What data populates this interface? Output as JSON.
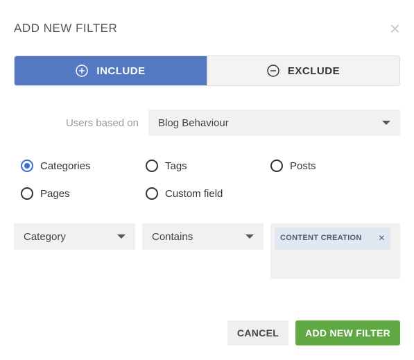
{
  "header": {
    "title": "ADD NEW FILTER"
  },
  "tabs": {
    "include": "INCLUDE",
    "exclude": "EXCLUDE"
  },
  "basis": {
    "label": "Users based on",
    "value": "Blog Behaviour"
  },
  "radios": {
    "categories": "Categories",
    "tags": "Tags",
    "posts": "Posts",
    "pages": "Pages",
    "custom_field": "Custom field"
  },
  "criteria": {
    "field": "Category",
    "operator": "Contains"
  },
  "chip": {
    "label": "CONTENT CREATION"
  },
  "footer": {
    "cancel": "CANCEL",
    "submit": "ADD NEW FILTER"
  }
}
